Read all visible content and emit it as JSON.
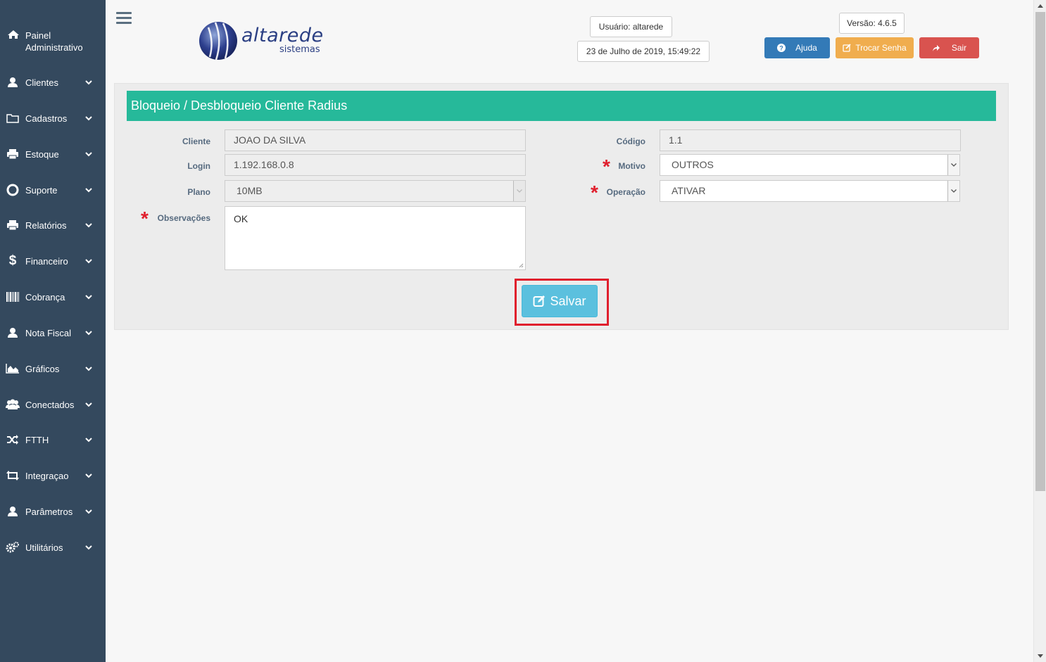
{
  "sidebar": {
    "home_label": "Painel Administrativo",
    "items": [
      {
        "label": "Clientes",
        "icon": "user-icon"
      },
      {
        "label": "Cadastros",
        "icon": "folder-icon"
      },
      {
        "label": "Estoque",
        "icon": "printer-icon"
      },
      {
        "label": "Suporte",
        "icon": "lifebuoy-icon"
      },
      {
        "label": "Relatórios",
        "icon": "printer-icon"
      },
      {
        "label": "Financeiro",
        "icon": "dollar-icon"
      },
      {
        "label": "Cobrança",
        "icon": "barcode-icon"
      },
      {
        "label": "Nota Fiscal",
        "icon": "user-icon"
      },
      {
        "label": "Gráficos",
        "icon": "area-chart-icon"
      },
      {
        "label": "Conectados",
        "icon": "users-icon"
      },
      {
        "label": "FTTH",
        "icon": "shuffle-icon"
      },
      {
        "label": "Integraçao",
        "icon": "retweet-icon"
      },
      {
        "label": "Parâmetros",
        "icon": "user-icon"
      },
      {
        "label": "Utilitários",
        "icon": "cogs-icon"
      }
    ]
  },
  "header": {
    "logo_text": "altarede",
    "logo_sub": "sistemas",
    "user": "Usuário: altarede",
    "datetime": "23 de Julho de 2019, 15:49:22",
    "version": "Versão: 4.6.5",
    "help_label": "Ajuda",
    "change_password_label": "Trocar Senha",
    "logout_label": "Sair"
  },
  "form": {
    "title": "Bloqueio / Desbloqueio Cliente Radius",
    "cliente_label": "Cliente",
    "cliente_value": "JOAO DA SILVA",
    "login_label": "Login",
    "login_value": "1.192.168.0.8",
    "plano_label": "Plano",
    "plano_value": "10MB",
    "observacoes_label": "Observações",
    "observacoes_value": "OK",
    "codigo_label": "Código",
    "codigo_value": "1.1",
    "motivo_label": "Motivo",
    "motivo_value": "OUTROS",
    "operacao_label": "Operação",
    "operacao_value": "ATIVAR",
    "required_mark": "*",
    "save_label": "Salvar"
  }
}
